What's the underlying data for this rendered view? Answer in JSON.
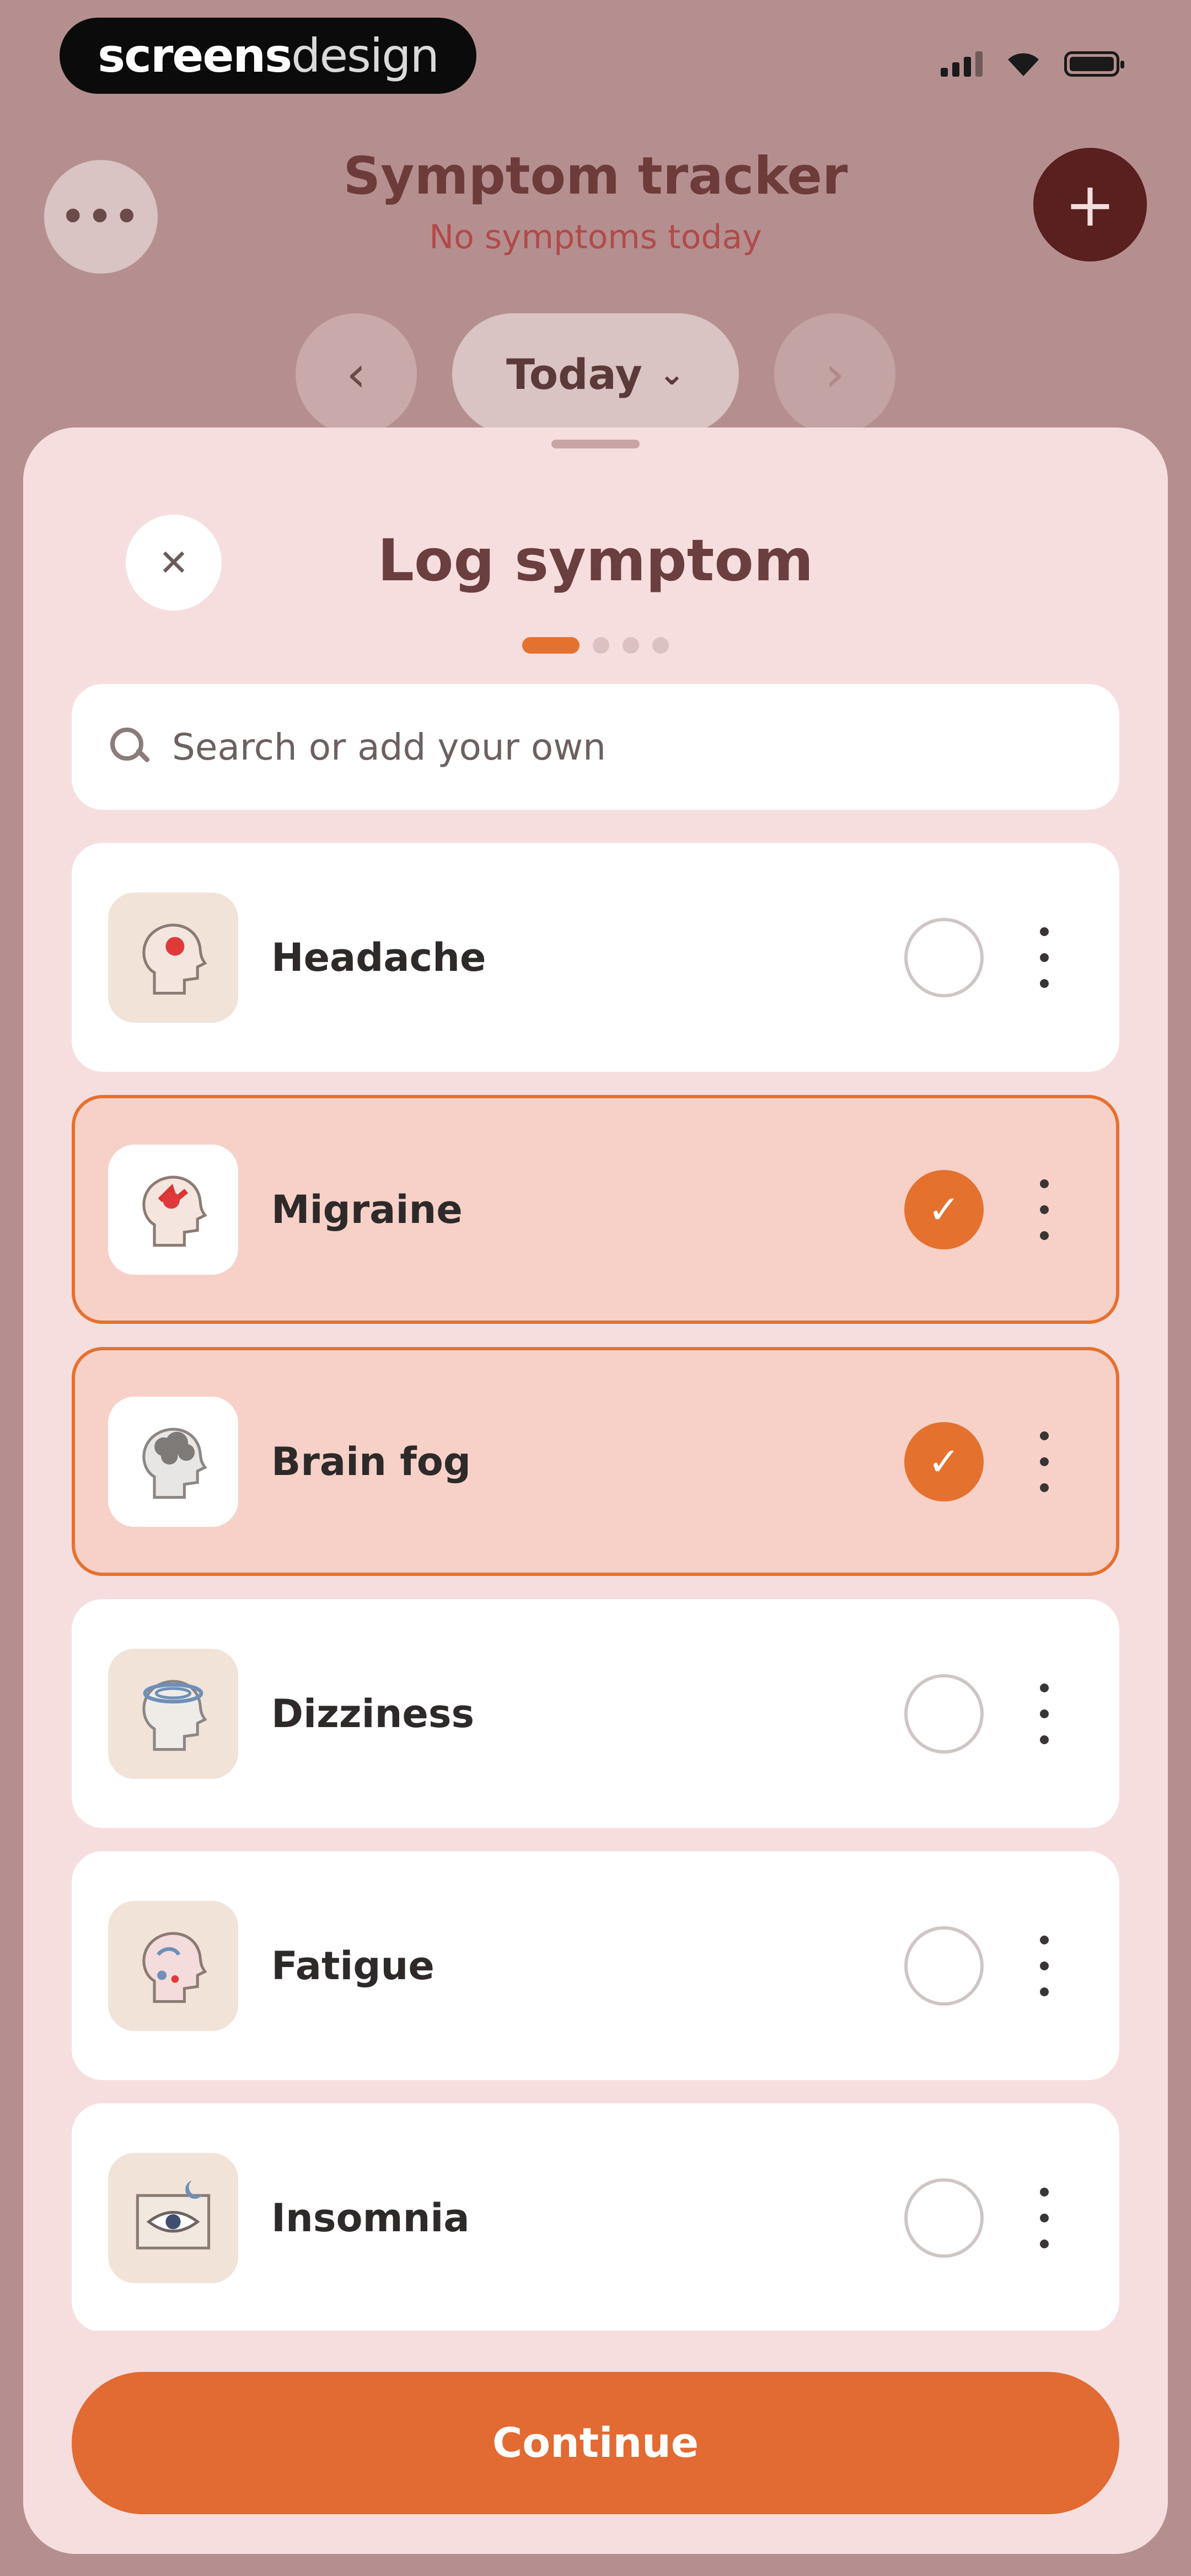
{
  "brand": {
    "part1": "screens",
    "part2": "design"
  },
  "header": {
    "more_label": "•••",
    "title": "Symptom tracker",
    "subtitle": "No symptoms today",
    "add_label": "+"
  },
  "date_nav": {
    "prev_label": "‹",
    "current": "Today",
    "dropdown_glyph": "⌄",
    "next_label": "›"
  },
  "sheet": {
    "close_label": "✕",
    "title": "Log symptom",
    "step_current": 1,
    "step_total": 4,
    "search_placeholder": "Search or add your own",
    "items": [
      {
        "label": "Headache",
        "selected": false,
        "icon": "head-red-spot-icon"
      },
      {
        "label": "Migraine",
        "selected": true,
        "icon": "head-pain-icon"
      },
      {
        "label": "Brain fog",
        "selected": true,
        "icon": "head-fog-icon"
      },
      {
        "label": "Dizziness",
        "selected": false,
        "icon": "head-spinning-icon"
      },
      {
        "label": "Fatigue",
        "selected": false,
        "icon": "head-tired-icon"
      },
      {
        "label": "Insomnia",
        "selected": false,
        "icon": "eye-awake-icon"
      }
    ],
    "check_glyph": "✓",
    "continue_label": "Continue"
  },
  "colors": {
    "accent": "#e5712f",
    "selected_bg": "#f7d1c8",
    "sheet_bg": "#f7dede",
    "backdrop": "#b58f8f",
    "title_color": "#6b3f3f"
  }
}
